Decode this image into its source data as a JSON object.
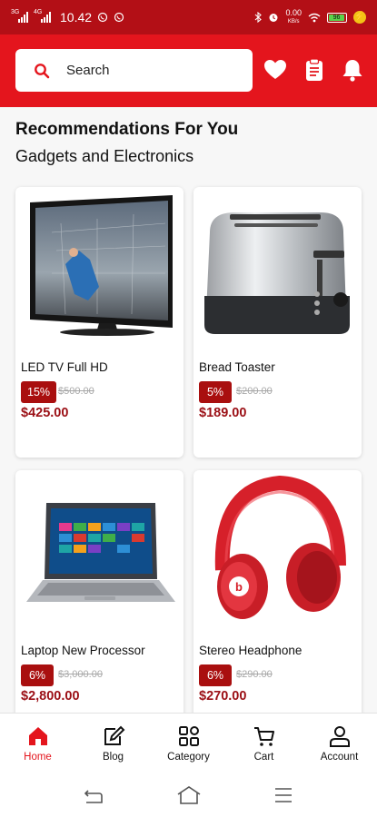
{
  "status_bar": {
    "time": "10.42",
    "net_labels": [
      "3G",
      "4G"
    ],
    "speed": "0.00",
    "speed_unit": "KB/s",
    "battery": "96"
  },
  "header": {
    "search_placeholder": "Search",
    "icons": [
      "heart-icon",
      "clipboard-icon",
      "bell-icon"
    ]
  },
  "section": {
    "title": "Recommendations For You",
    "subtitle": "Gadgets and Electronics"
  },
  "products": [
    {
      "name": "LED TV Full HD",
      "discount": "15%",
      "old_price": "$500.00",
      "price": "$425.00"
    },
    {
      "name": "Bread Toaster",
      "discount": "5%",
      "old_price": "$200.00",
      "price": "$189.00"
    },
    {
      "name": "Laptop New Processor",
      "discount": "6%",
      "old_price": "$3,000.00",
      "price": "$2,800.00"
    },
    {
      "name": "Stereo Headphone",
      "discount": "6%",
      "old_price": "$290.00",
      "price": "$270.00"
    }
  ],
  "bottom_nav": [
    {
      "label": "Home",
      "icon": "home-icon",
      "active": true
    },
    {
      "label": "Blog",
      "icon": "blog-icon",
      "active": false
    },
    {
      "label": "Category",
      "icon": "category-icon",
      "active": false
    },
    {
      "label": "Cart",
      "icon": "cart-icon",
      "active": false
    },
    {
      "label": "Account",
      "icon": "account-icon",
      "active": false
    }
  ],
  "colors": {
    "header": "#e4151d",
    "status_bar": "#b30f16",
    "price": "#9b0f15",
    "discount_badge": "#a90f0f"
  }
}
